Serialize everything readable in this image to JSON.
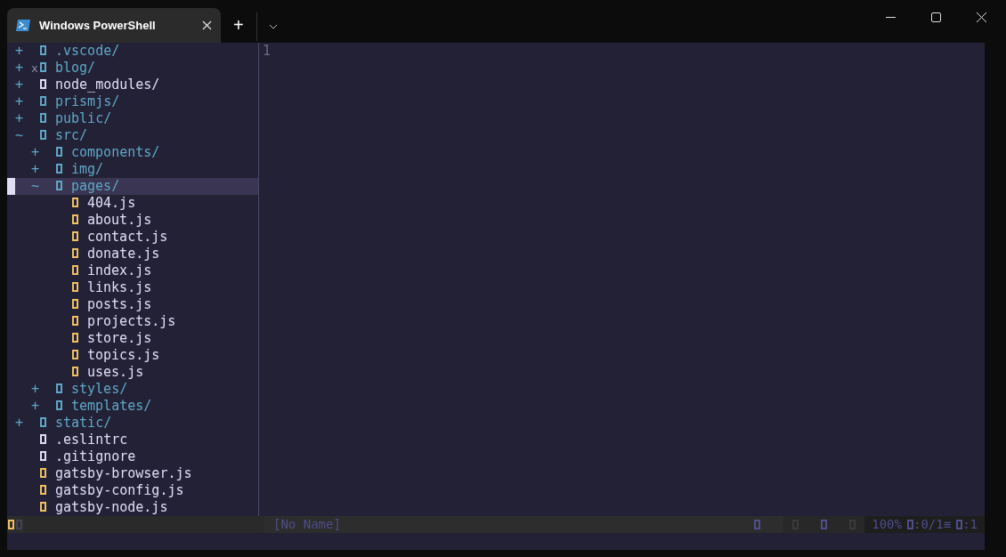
{
  "window": {
    "tab_title": "Windows PowerShell",
    "new_tab": "+"
  },
  "tree": [
    {
      "name": ".vscode/",
      "kind": "folder",
      "sign": "+",
      "color": "#5ea7c6",
      "selected": false
    },
    {
      "name": "blog/",
      "kind": "folder",
      "sign": "+",
      "mark": "x",
      "color": "#5ea7c6",
      "selected": false
    },
    {
      "name": "node_modules/",
      "kind": "folder",
      "sign": "+",
      "color": "#e0def4",
      "selected": false
    },
    {
      "name": "prismjs/",
      "kind": "folder",
      "sign": "+",
      "color": "#5ea7c6",
      "selected": false
    },
    {
      "name": "public/",
      "kind": "folder",
      "sign": "+",
      "color": "#5ea7c6",
      "selected": false
    },
    {
      "name": "src/",
      "kind": "folder",
      "sign": "~",
      "color": "#5ea7c6",
      "selected": false,
      "children": [
        {
          "name": "components/",
          "kind": "folder",
          "sign": "+",
          "color": "#5ea7c6",
          "selected": false
        },
        {
          "name": "img/",
          "kind": "folder",
          "sign": "+",
          "color": "#5ea7c6",
          "selected": false
        },
        {
          "name": "pages/",
          "kind": "folder",
          "sign": "~",
          "color": "#5ea7c6",
          "selected": true,
          "children": [
            {
              "name": "404.js",
              "kind": "file",
              "color": "#f0c060",
              "selected": false
            },
            {
              "name": "about.js",
              "kind": "file",
              "color": "#f0c060",
              "selected": false
            },
            {
              "name": "contact.js",
              "kind": "file",
              "color": "#f0c060",
              "selected": false
            },
            {
              "name": "donate.js",
              "kind": "file",
              "color": "#f0c060",
              "selected": false
            },
            {
              "name": "index.js",
              "kind": "file",
              "color": "#f0c060",
              "selected": false
            },
            {
              "name": "links.js",
              "kind": "file",
              "color": "#f0c060",
              "selected": false
            },
            {
              "name": "posts.js",
              "kind": "file",
              "color": "#f0c060",
              "selected": false
            },
            {
              "name": "projects.js",
              "kind": "file",
              "color": "#f0c060",
              "selected": false
            },
            {
              "name": "store.js",
              "kind": "file",
              "color": "#f0c060",
              "selected": false
            },
            {
              "name": "topics.js",
              "kind": "file",
              "color": "#f0c060",
              "selected": false
            },
            {
              "name": "uses.js",
              "kind": "file",
              "color": "#f0c060",
              "selected": false
            }
          ]
        },
        {
          "name": "styles/",
          "kind": "folder",
          "sign": "+",
          "color": "#5ea7c6",
          "selected": false
        },
        {
          "name": "templates/",
          "kind": "folder",
          "sign": "+",
          "color": "#5ea7c6",
          "selected": false
        }
      ]
    },
    {
      "name": "static/",
      "kind": "folder",
      "sign": "+",
      "color": "#5ea7c6",
      "selected": false
    },
    {
      "name": ".eslintrc",
      "kind": "file",
      "color": "#e0def4",
      "selected": false
    },
    {
      "name": ".gitignore",
      "kind": "file",
      "color": "#e0def4",
      "selected": false
    },
    {
      "name": "gatsby-browser.js",
      "kind": "file",
      "color": "#f0c060",
      "selected": false
    },
    {
      "name": "gatsby-config.js",
      "kind": "file",
      "color": "#f0c060",
      "selected": false
    },
    {
      "name": "gatsby-node.js",
      "kind": "file",
      "color": "#f0c060",
      "selected": false
    }
  ],
  "editor": {
    "line_numbers": [
      "1"
    ]
  },
  "status_bar": {
    "buffer": "[No Name]",
    "percent": "100%",
    "position": ":0/1≡",
    "column": ":1"
  }
}
